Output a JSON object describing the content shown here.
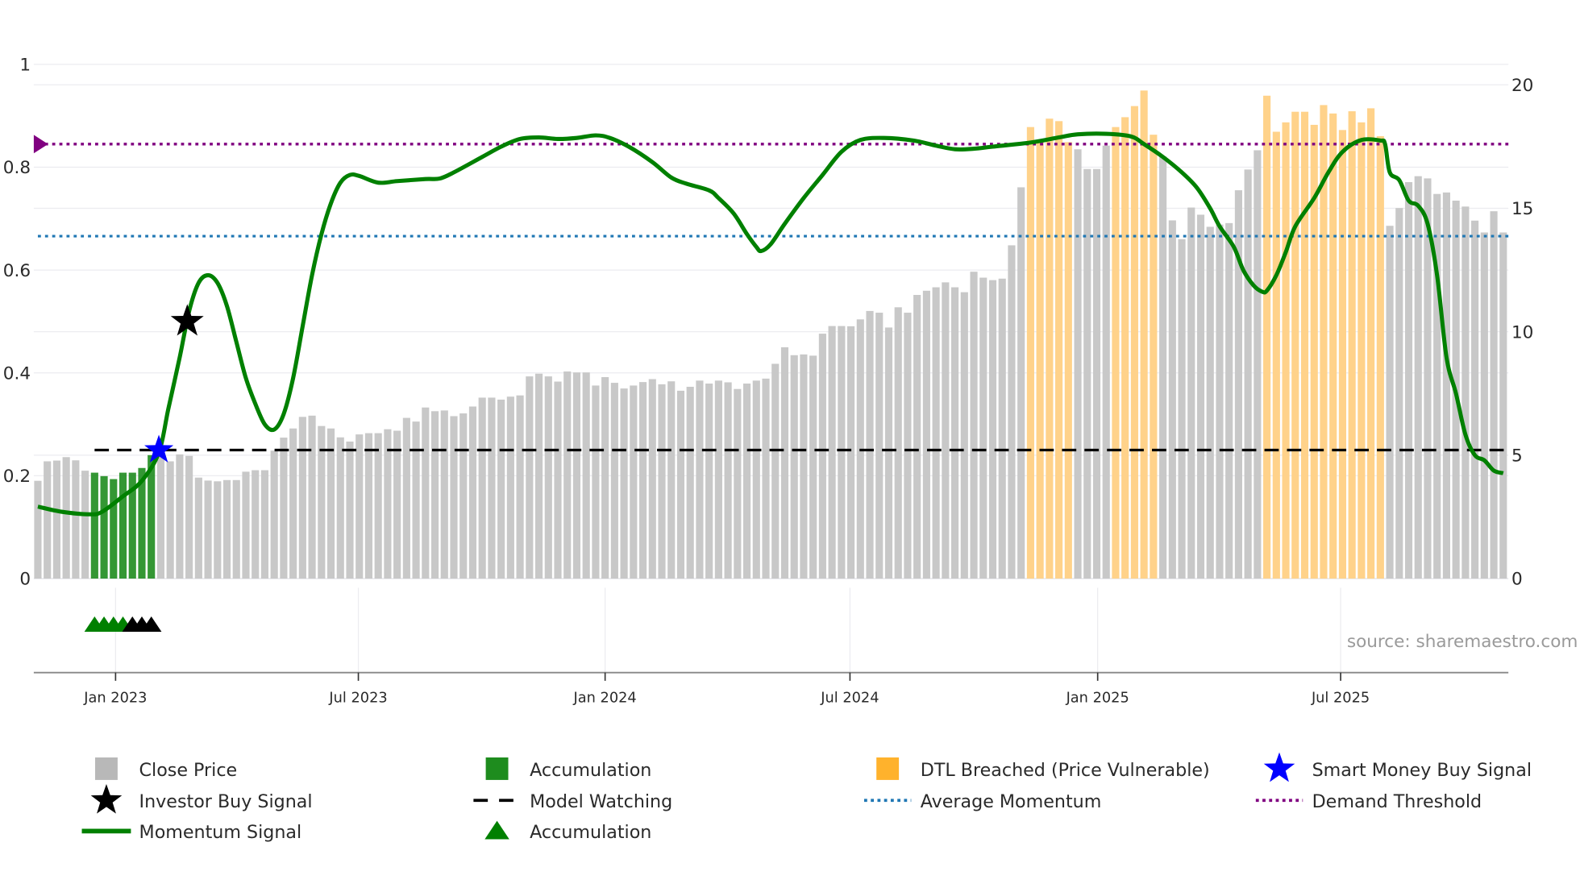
{
  "chart_data": {
    "type": "bar",
    "title": "",
    "x_unit": "week index (weekly bars)",
    "x_ticks": [
      {
        "label": "Jan 2023",
        "week": 9.22
      },
      {
        "label": "Jul 2023",
        "week": 34.9
      },
      {
        "label": "Jan 2024",
        "week": 61.0
      },
      {
        "label": "Jul 2024",
        "week": 86.9
      },
      {
        "label": "Jan 2025",
        "week": 113.1
      },
      {
        "label": "Jul 2025",
        "week": 138.8
      }
    ],
    "left_axis": {
      "range": [
        0,
        1
      ],
      "ticks": [
        "0",
        "0.2",
        "0.4",
        "0.6",
        "0.8",
        "1"
      ],
      "tick_values": [
        0,
        0.2,
        0.4,
        0.6,
        0.8,
        1
      ]
    },
    "right_axis": {
      "range": [
        0,
        20.83
      ],
      "ticks": [
        "0",
        "5",
        "10",
        "15",
        "20"
      ],
      "tick_values": [
        0,
        5,
        10,
        15,
        20
      ]
    },
    "grid": true,
    "legend_placement": "bottom",
    "close_price": [
      3.96,
      4.75,
      4.78,
      4.92,
      4.79,
      4.37,
      4.29,
      4.15,
      4.03,
      4.29,
      4.29,
      4.48,
      5.0,
      4.92,
      4.75,
      5.03,
      4.97,
      4.09,
      3.97,
      3.94,
      3.99,
      3.99,
      4.33,
      4.39,
      4.39,
      5.18,
      5.71,
      6.08,
      6.55,
      6.6,
      6.18,
      6.08,
      5.72,
      5.55,
      5.84,
      5.89,
      5.89,
      6.05,
      5.99,
      6.51,
      6.36,
      6.93,
      6.78,
      6.81,
      6.58,
      6.69,
      6.97,
      7.33,
      7.33,
      7.25,
      7.37,
      7.42,
      8.19,
      8.3,
      8.19,
      7.98,
      8.39,
      8.35,
      8.35,
      7.82,
      8.16,
      7.93,
      7.7,
      7.82,
      7.96,
      8.08,
      7.87,
      7.99,
      7.61,
      7.77,
      8.02,
      7.9,
      8.02,
      7.95,
      7.68,
      7.9,
      8.02,
      8.1,
      8.7,
      9.37,
      9.05,
      9.08,
      9.03,
      9.92,
      10.23,
      10.23,
      10.22,
      10.5,
      10.84,
      10.77,
      10.17,
      10.99,
      10.77,
      11.49,
      11.66,
      11.8,
      12.0,
      11.8,
      11.6,
      12.43,
      12.19,
      12.09,
      12.15,
      13.5,
      15.85,
      18.29,
      17.77,
      18.63,
      18.53,
      17.68,
      17.39,
      16.59,
      16.59,
      17.54,
      18.29,
      18.69,
      19.14,
      19.77,
      17.98,
      17.1,
      14.51,
      13.75,
      15.03,
      14.74,
      14.25,
      14.34,
      14.4,
      15.73,
      16.57,
      17.35,
      19.56,
      18.1,
      18.48,
      18.91,
      18.91,
      18.38,
      19.18,
      18.84,
      18.17,
      18.93,
      18.48,
      19.05,
      17.92,
      14.29,
      15.01,
      16.06,
      16.3,
      16.21,
      15.58,
      15.64,
      15.31,
      15.07,
      14.5,
      14.02,
      14.88,
      14.02
    ],
    "accumulation_weeks": [
      [
        7,
        13
      ]
    ],
    "dtl_breached_weeks": [
      [
        106,
        110
      ],
      [
        115,
        119
      ],
      [
        131,
        143
      ]
    ],
    "momentum_signal": [
      [
        1,
        0.14
      ],
      [
        3.5,
        0.13
      ],
      [
        6.5,
        0.125
      ],
      [
        7.8,
        0.13
      ],
      [
        10,
        0.16
      ],
      [
        12,
        0.19
      ],
      [
        13.8,
        0.245
      ],
      [
        14.8,
        0.33
      ],
      [
        16,
        0.43
      ],
      [
        17,
        0.52
      ],
      [
        18,
        0.575
      ],
      [
        19,
        0.59
      ],
      [
        20,
        0.575
      ],
      [
        21,
        0.53
      ],
      [
        22,
        0.46
      ],
      [
        23,
        0.39
      ],
      [
        24,
        0.34
      ],
      [
        25,
        0.3
      ],
      [
        26,
        0.29
      ],
      [
        27,
        0.32
      ],
      [
        28,
        0.39
      ],
      [
        29,
        0.49
      ],
      [
        30,
        0.59
      ],
      [
        31,
        0.67
      ],
      [
        32,
        0.73
      ],
      [
        33,
        0.77
      ],
      [
        34,
        0.785
      ],
      [
        35,
        0.783
      ],
      [
        37,
        0.77
      ],
      [
        39,
        0.773
      ],
      [
        42,
        0.777
      ],
      [
        43.5,
        0.778
      ],
      [
        45,
        0.79
      ],
      [
        48,
        0.82
      ],
      [
        50,
        0.84
      ],
      [
        52,
        0.855
      ],
      [
        54,
        0.858
      ],
      [
        56,
        0.855
      ],
      [
        58,
        0.857
      ],
      [
        60,
        0.862
      ],
      [
        61.5,
        0.857
      ],
      [
        63.5,
        0.84
      ],
      [
        66,
        0.81
      ],
      [
        68,
        0.78
      ],
      [
        69.6,
        0.768
      ],
      [
        72,
        0.755
      ],
      [
        73,
        0.74
      ],
      [
        74.6,
        0.71
      ],
      [
        76,
        0.67
      ],
      [
        77,
        0.645
      ],
      [
        77.5,
        0.637
      ],
      [
        78.5,
        0.65
      ],
      [
        80,
        0.69
      ],
      [
        82,
        0.74
      ],
      [
        84,
        0.785
      ],
      [
        86,
        0.83
      ],
      [
        88,
        0.853
      ],
      [
        90.5,
        0.857
      ],
      [
        93.6,
        0.852
      ],
      [
        96,
        0.842
      ],
      [
        98,
        0.835
      ],
      [
        100,
        0.836
      ],
      [
        102,
        0.84
      ],
      [
        106,
        0.848
      ],
      [
        109,
        0.858
      ],
      [
        111,
        0.864
      ],
      [
        114,
        0.865
      ],
      [
        116.6,
        0.86
      ],
      [
        118,
        0.845
      ],
      [
        120,
        0.82
      ],
      [
        122,
        0.79
      ],
      [
        123.6,
        0.76
      ],
      [
        125,
        0.72
      ],
      [
        126,
        0.685
      ],
      [
        127.5,
        0.645
      ],
      [
        128.5,
        0.6
      ],
      [
        129.6,
        0.57
      ],
      [
        130.5,
        0.558
      ],
      [
        131,
        0.56
      ],
      [
        132,
        0.59
      ],
      [
        133,
        0.635
      ],
      [
        134,
        0.685
      ],
      [
        136,
        0.74
      ],
      [
        137.5,
        0.79
      ],
      [
        139,
        0.83
      ],
      [
        141,
        0.853
      ],
      [
        143,
        0.852
      ],
      [
        143.5,
        0.845
      ],
      [
        144,
        0.79
      ],
      [
        145,
        0.775
      ],
      [
        146,
        0.735
      ],
      [
        147,
        0.725
      ],
      [
        148,
        0.69
      ],
      [
        149,
        0.59
      ],
      [
        150,
        0.43
      ],
      [
        151,
        0.36
      ],
      [
        152,
        0.28
      ],
      [
        153,
        0.24
      ],
      [
        154,
        0.23
      ],
      [
        155,
        0.21
      ],
      [
        156,
        0.205
      ]
    ],
    "demand_threshold": 0.845,
    "average_momentum": 0.666,
    "model_watching": {
      "value": 0.25,
      "from_week": 7
    },
    "smart_money_buy_signal": {
      "week": 13.8,
      "value": 0.25
    },
    "investor_buy_signal": {
      "week": 16.8,
      "value": 0.5
    },
    "accumulation_triangles_green": [
      7,
      8,
      9,
      10
    ],
    "accumulation_triangles_black": [
      11,
      12,
      13
    ],
    "annotation": "source: sharemaestro.com",
    "legend": [
      {
        "label": "Close Price",
        "symbol": "square",
        "color": "#b8b8b8"
      },
      {
        "label": "Accumulation",
        "symbol": "square",
        "color": "#1e8c1e"
      },
      {
        "label": "DTL Breached (Price Vulnerable)",
        "symbol": "square",
        "color": "#ffb22c"
      },
      {
        "label": "Smart Money Buy Signal",
        "symbol": "star",
        "color": "#0000ff"
      },
      {
        "label": "Investor Buy Signal",
        "symbol": "star",
        "color": "#000000"
      },
      {
        "label": "Model Watching",
        "symbol": "dash",
        "color": "#000000"
      },
      {
        "label": "Average Momentum",
        "symbol": "dot",
        "color": "#1f77b4"
      },
      {
        "label": "Demand Threshold",
        "symbol": "dot",
        "color": "#800080"
      },
      {
        "label": "Momentum Signal",
        "symbol": "line",
        "color": "#008000"
      },
      {
        "label": "Accumulation",
        "symbol": "triangle",
        "color": "#008000"
      }
    ],
    "colors": {
      "price": "#c8c8c8",
      "accumulation": "#1e8c1e",
      "dtl": "#ffd28a",
      "momentum": "#008000",
      "threshold": "#800080",
      "average": "#1f77b4"
    }
  }
}
